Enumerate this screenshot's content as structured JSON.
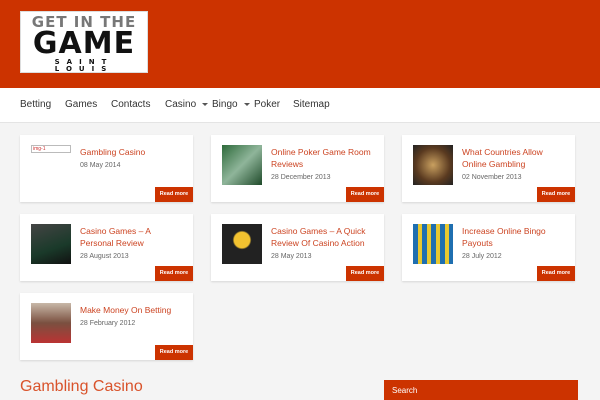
{
  "logo": {
    "line1": "GET IN THE",
    "line2": "GAME",
    "line3": "SAINT LOUIS"
  },
  "nav": [
    {
      "label": "Betting"
    },
    {
      "label": "Games"
    },
    {
      "label": "Contacts"
    },
    {
      "label": "Casino"
    },
    {
      "label": "Bingo"
    },
    {
      "label": "Poker"
    },
    {
      "label": "Sitemap"
    }
  ],
  "read_more": "Read more",
  "posts": [
    {
      "title": "Gambling Casino",
      "date": "08 May 2014",
      "img_alt": "img-1"
    },
    {
      "title": "Online Poker Game Room Reviews",
      "date": "28 December 2013"
    },
    {
      "title": "What Countries Allow Online Gambling",
      "date": "02 November 2013"
    },
    {
      "title": "Casino Games – A Personal Review",
      "date": "28 August 2013"
    },
    {
      "title": "Casino Games – A Quick Review Of Casino Action",
      "date": "28 May 2013"
    },
    {
      "title": "Increase Online Bingo Payouts",
      "date": "28 July 2012"
    },
    {
      "title": "Make Money On Betting",
      "date": "28 February 2012"
    }
  ],
  "main": {
    "title": "Gambling Casino"
  },
  "search": {
    "placeholder": "Search"
  }
}
